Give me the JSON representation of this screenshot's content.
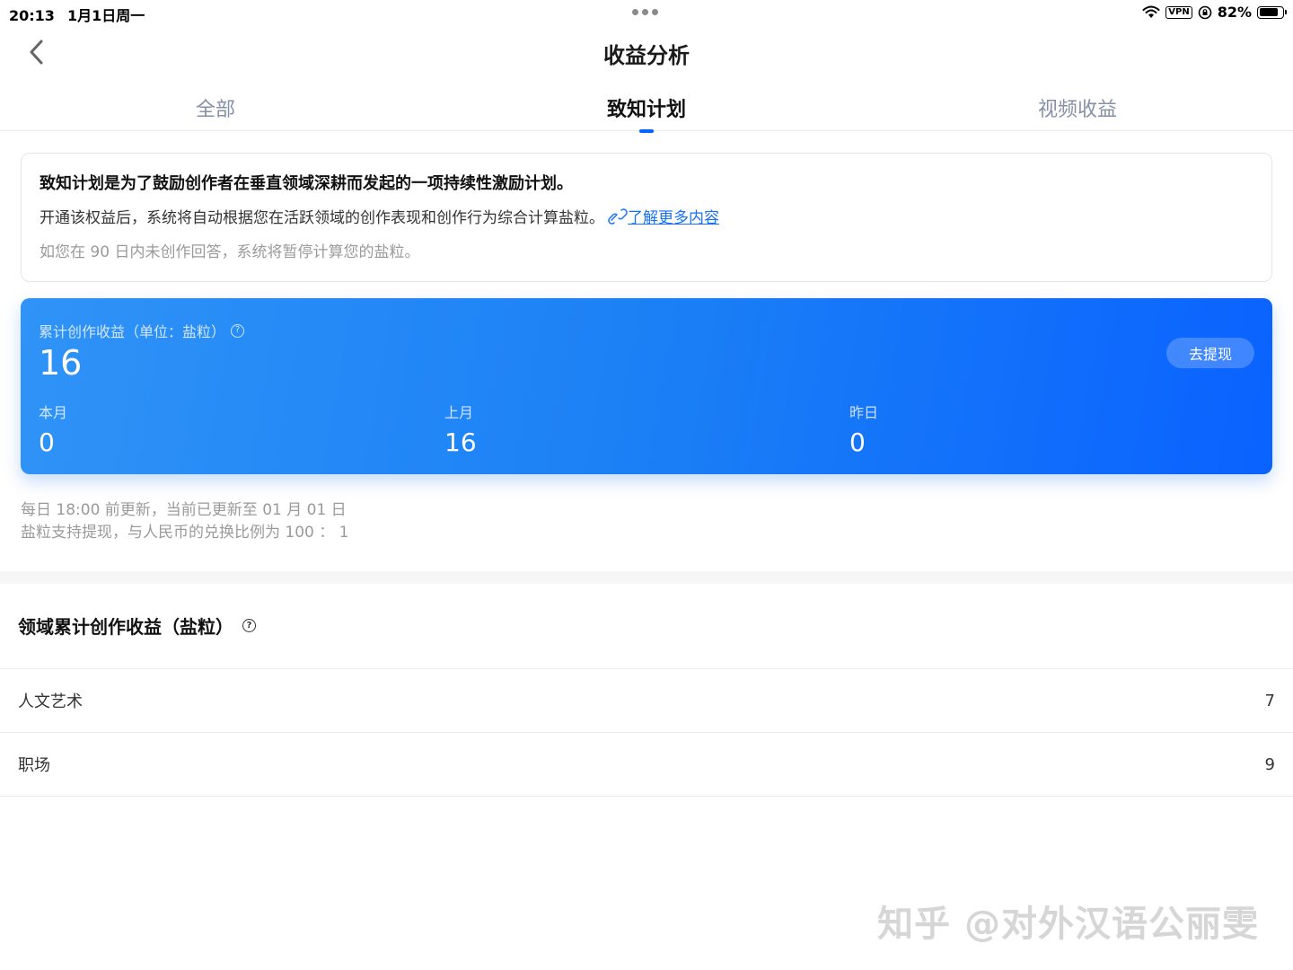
{
  "status_bar": {
    "time": "20:13",
    "date": "1月1日周一",
    "vpn": "VPN",
    "battery": "82%",
    "battery_level": 0.82
  },
  "header": {
    "title": "收益分析"
  },
  "tabs": [
    {
      "label": "全部",
      "active": false
    },
    {
      "label": "致知计划",
      "active": true
    },
    {
      "label": "视频收益",
      "active": false
    }
  ],
  "info": {
    "line1": "致知计划是为了鼓励创作者在垂直领域深耕而发起的一项持续性激励计划。",
    "line2": "开通该权益后，系统将自动根据您在活跃领域的创作表现和创作行为综合计算盐粒。",
    "link_label": "了解更多内容",
    "line3": "如您在 90 日内未创作回答，系统将暂停计算您的盐粒。"
  },
  "earnings": {
    "label": "累计创作收益（单位：盐粒）",
    "total": "16",
    "withdraw_label": "去提现",
    "stats": [
      {
        "label": "本月",
        "value": "0"
      },
      {
        "label": "上月",
        "value": "16"
      },
      {
        "label": "昨日",
        "value": "0"
      }
    ]
  },
  "notes": {
    "update": "每日 18:00 前更新，当前已更新至 01 月 01 日",
    "exchange": "盐粒支持提现，与人民币的兑换比例为 100 ： 1"
  },
  "domain": {
    "title": "领域累计创作收益（盐粒）",
    "rows": [
      {
        "name": "人文艺术",
        "value": "7"
      },
      {
        "name": "职场",
        "value": "9"
      }
    ]
  },
  "watermark": "知乎 @对外汉语公丽雯",
  "colors": {
    "accent": "#0066ff",
    "link": "#1772f6",
    "card_gradient_start": "#2f93f7",
    "card_gradient_end": "#0a62ff"
  }
}
